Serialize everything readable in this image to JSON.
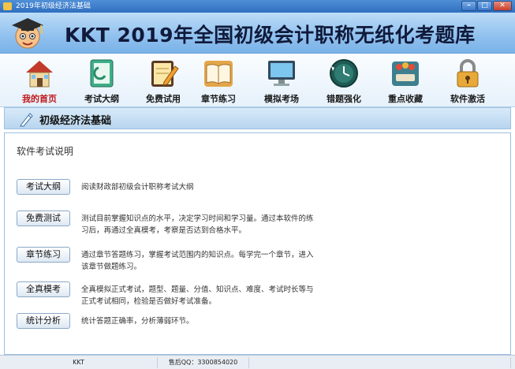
{
  "window": {
    "title": "2019年初级经济法基础",
    "minimize_glyph": "–",
    "maximize_glyph": "□",
    "close_glyph": "✕"
  },
  "banner": {
    "title": "KKT 2019年全国初级会计职称无纸化考题库"
  },
  "toolbar": {
    "items": [
      {
        "label": "我的首页",
        "icon": "home-icon",
        "active": true
      },
      {
        "label": "考试大纲",
        "icon": "outline-book-icon"
      },
      {
        "label": "免费试用",
        "icon": "notepad-pencil-icon"
      },
      {
        "label": "章节练习",
        "icon": "open-book-icon"
      },
      {
        "label": "模拟考场",
        "icon": "monitor-icon"
      },
      {
        "label": "错题强化",
        "icon": "clock-refresh-icon"
      },
      {
        "label": "重点收藏",
        "icon": "favorites-icon"
      },
      {
        "label": "软件激活",
        "icon": "lock-icon"
      }
    ]
  },
  "section": {
    "title": "初级经济法基础"
  },
  "content": {
    "heading": "软件考试说明",
    "rows": [
      {
        "button": "考试大纲",
        "desc": "阅读财政部初级会计职称考试大纲"
      },
      {
        "button": "免费测试",
        "desc": "测试目前掌握知识点的水平，决定学习时间和学习量。通过本软件的练习后，再通过全真模考，考察是否达到合格水平。"
      },
      {
        "button": "章节练习",
        "desc": "通过章节答题练习，掌握考试范围内的知识点。每学完一个章节，进入该章节做题练习。"
      },
      {
        "button": "全真模考",
        "desc": "全真模拟正式考试，题型、题量、分值、知识点、难度、考试时长等与正式考试相同，检验是否做好考试准备。"
      },
      {
        "button": "统计分析",
        "desc": "统计答题正确率，分析薄弱环节。"
      }
    ]
  },
  "statusbar": {
    "left": "KKT",
    "mid": "售后QQ：3300854020",
    "right": ""
  },
  "colors": {
    "banner_top": "#bcdcf7",
    "banner_bottom": "#7ab2e8",
    "active_label": "#c0181a"
  }
}
